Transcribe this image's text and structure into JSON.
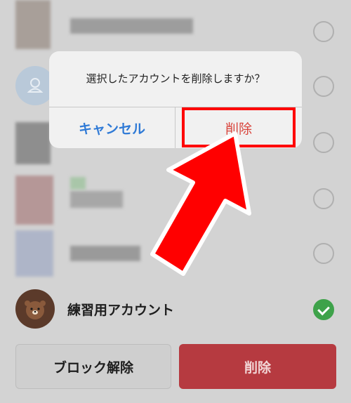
{
  "dialog": {
    "message": "選択したアカウントを削除しますか？",
    "cancel_label": "キャンセル",
    "delete_label": "削除"
  },
  "account": {
    "name": "練習用アカウント",
    "selected": true
  },
  "buttons": {
    "unblock_label": "ブロック解除",
    "delete_label": "削除"
  },
  "colors": {
    "check_green": "#3ea24a",
    "delete_red": "#b63a40",
    "cancel_blue": "#2f7ad6",
    "highlight_red": "#ff0000",
    "arrow_red": "#ff0000"
  }
}
